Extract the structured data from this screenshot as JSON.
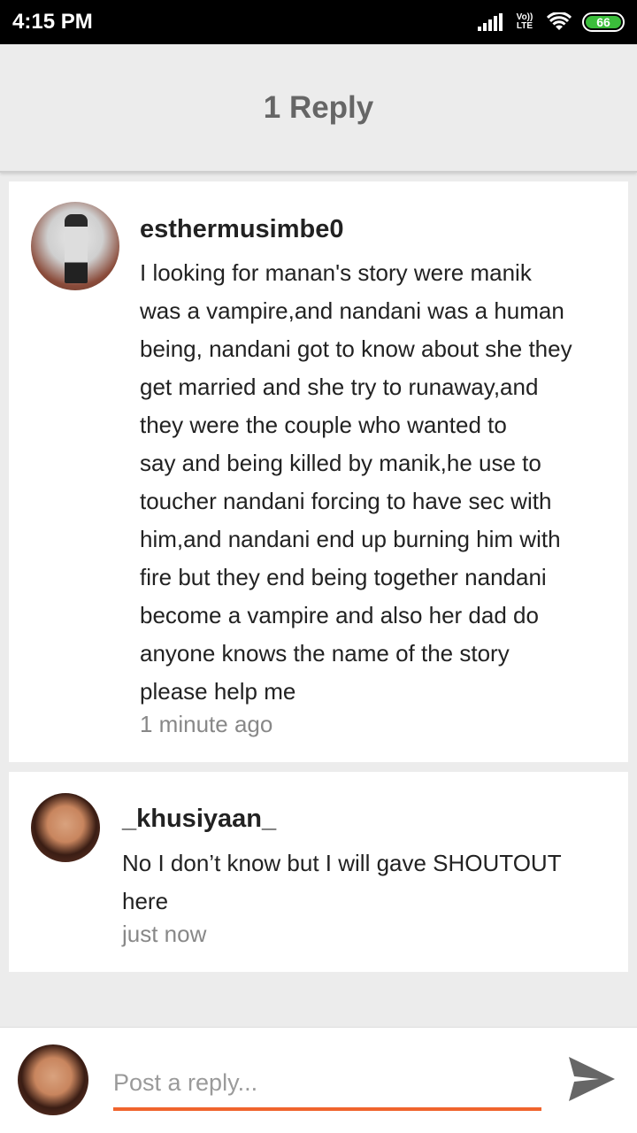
{
  "status_bar": {
    "time": "4:15 PM",
    "network": "Vo)) LTE",
    "battery": "66"
  },
  "header": {
    "title": "1 Reply"
  },
  "comment": {
    "username": "esthermusimbe0",
    "text": "I looking for manan's story were manik\nwas a vampire,and nandani was a human\nbeing, nandani got to know about she they\nget married and she try to runaway,and\nthey were the couple who wanted to\nsay and being killed by manik,he use to\ntoucher nandani forcing to have sec with\nhim,and nandani end up burning him with\nfire but they end being together nandani\nbecome a vampire  and also her dad do\nanyone knows the name of the story\nplease help me",
    "time": "1 minute ago"
  },
  "reply": {
    "username": "_khusiyaan_",
    "text": "No I don’t know but I will gave SHOUTOUT\nhere",
    "time": "just now"
  },
  "composer": {
    "placeholder": "Post a reply...",
    "accent_color": "#f0642d",
    "send_icon": "send-icon"
  }
}
